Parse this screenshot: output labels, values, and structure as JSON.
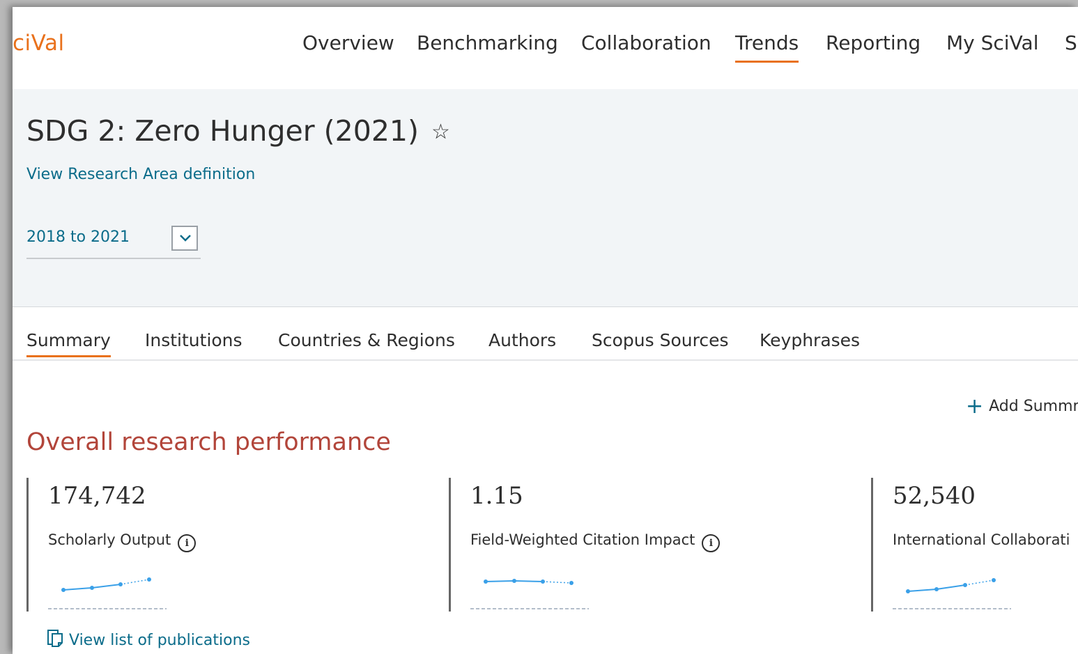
{
  "nav": {
    "logo": "ciVal",
    "items": [
      "Overview",
      "Benchmarking",
      "Collaboration",
      "Trends",
      "Reporting",
      "My SciVal",
      "S"
    ],
    "active": "Trends"
  },
  "header": {
    "title": "SDG 2: Zero Hunger (2021)",
    "favorite_icon": "star-outline-icon",
    "definition_link": "View Research Area definition",
    "date_range": "2018 to 2021"
  },
  "tabs": {
    "items": [
      "Summary",
      "Institutions",
      "Countries & Regions",
      "Authors",
      "Scopus Sources",
      "Keyphrases"
    ],
    "active": "Summary"
  },
  "content": {
    "add_summary": "Add Summm",
    "section_title": "Overall research performance",
    "metrics": [
      {
        "value": "174,742",
        "label": "Scholarly Output"
      },
      {
        "value": "1.15",
        "label": "Field-Weighted Citation Impact"
      },
      {
        "value": "52,540",
        "label": "International Collaborati"
      }
    ],
    "view_publications": "View list of publications"
  },
  "colors": {
    "accent": "#e9711c",
    "link": "#0b6c8a",
    "section_title": "#b2453a",
    "sparkline": "#3aa0e8"
  }
}
